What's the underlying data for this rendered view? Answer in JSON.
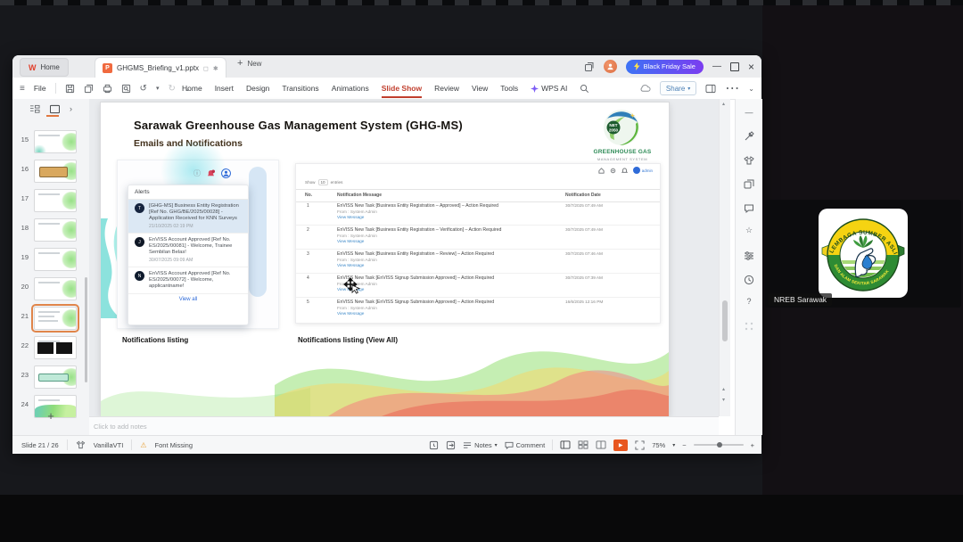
{
  "window": {
    "home_label": "Home",
    "doc_title": "GHGMS_Briefing_v1.pptx",
    "new_label": "New",
    "promo_label": "Black Friday Sale",
    "file_label": "File",
    "menu": [
      "Home",
      "Insert",
      "Design",
      "Transitions",
      "Animations",
      "Slide Show",
      "Review",
      "View",
      "Tools"
    ],
    "wps_ai_label": "WPS AI",
    "share_label": "Share"
  },
  "icons": {
    "hamburger": "≡",
    "chevron_down": "▾",
    "collapse": "⌄",
    "more": "⋯",
    "minimize": "—",
    "close": "×",
    "plus": "+",
    "minus": "−",
    "undo": "↺",
    "redo": "↻",
    "panel_arrow": "›",
    "warning": "⚠",
    "star": "☆",
    "help": "?",
    "scroll_up": "▴",
    "scroll_down": "▾",
    "modified": "✱",
    "device": "◻",
    "info": "ⓘ",
    "play": "▶"
  },
  "slide_panel": {
    "numbers": [
      "15",
      "16",
      "17",
      "18",
      "19",
      "20",
      "21",
      "22",
      "23",
      "24"
    ],
    "add_label": "+"
  },
  "slide": {
    "title": "Sarawak Greenhouse Gas Management System (GHG-MS)",
    "subtitle": "Emails and Notifications",
    "logo": {
      "badge_line1": "NET",
      "badge_line2": "2050",
      "name_line1": "GREENHOUSE GAS",
      "name_line2": "MANAGEMENT SYSTEM"
    },
    "alerts": {
      "header": "Alerts",
      "view_all": "View all",
      "items": [
        {
          "avatar": "T",
          "text": "[GHG-MS] Business Entity Registration [Ref No. GHG/BE/2025/00028] - Application Received for KNN Surveys",
          "date": "21/10/2025 02:19 PM"
        },
        {
          "avatar": "J",
          "text": "EnVISS Account Approved [Ref No. ES/2025/00081] - Welcome, Trainee Sembilan Belas!",
          "date": "30/07/2025 09:09 AM"
        },
        {
          "avatar": "N",
          "text": "EnVISS Account Approved [Ref No. ES/2025/00072] - Welcome, applicantname!",
          "date": ""
        }
      ]
    },
    "portal": {
      "admin_label": "admin",
      "show_label": "Show",
      "show_value": "10",
      "entries_label": "entries",
      "headers": [
        "No.",
        "Notification Message",
        "Notification Date"
      ],
      "rows": [
        {
          "no": "1",
          "message": "EnVISS New Task [Business Entity Registration – Approved] – Action Required",
          "from": "From : System Admin",
          "link": "View Message",
          "date": "30/7/2025 07:49 AM"
        },
        {
          "no": "2",
          "message": "EnVISS New Task [Business Entity Registration – Verification] – Action Required",
          "from": "From : System Admin",
          "link": "View Message",
          "date": "30/7/2025 07:49 AM"
        },
        {
          "no": "3",
          "message": "EnVISS New Task [Business Entity Registration – Review] – Action Required",
          "from": "From : System Admin",
          "link": "View Message",
          "date": "30/7/2025 07:46 AM"
        },
        {
          "no": "4",
          "message": "EnVISS New Task [EnVISS Signup Submission Approved] – Action Required",
          "from": "From : System Admin",
          "link": "View Message",
          "date": "30/7/2025 07:39 AM"
        },
        {
          "no": "5",
          "message": "EnVISS New Task [EnVISS Signup Submission Approved] – Action Required",
          "from": "From : System Admin",
          "link": "View Message",
          "date": "16/6/2025 12:16 PM"
        }
      ]
    },
    "captions": {
      "left": "Notifications listing",
      "right": "Notifications listing (View All)"
    }
  },
  "notes_placeholder": "Click to add notes",
  "status_bar": {
    "slide_info": "Slide 21 / 26",
    "theme_name": "VanillaVTI",
    "font_missing": "Font Missing",
    "notes_label": "Notes",
    "comment_label": "Comment",
    "zoom_value": "75%"
  },
  "meeting": {
    "participant_name": "NREB Sarawak",
    "logo_text_top": "LEMBAGA SUMBER ASLI",
    "logo_text_bottom": "DAN ALAM SEKITAR SARAWAK"
  },
  "colors": {
    "menu_accent": "#c13f2e",
    "promo_from": "#3d72f5",
    "promo_to": "#7b3df0",
    "link_blue": "#3f8ac9",
    "play_orange": "#e8571f",
    "selected_thumb_border": "#e0854a"
  }
}
